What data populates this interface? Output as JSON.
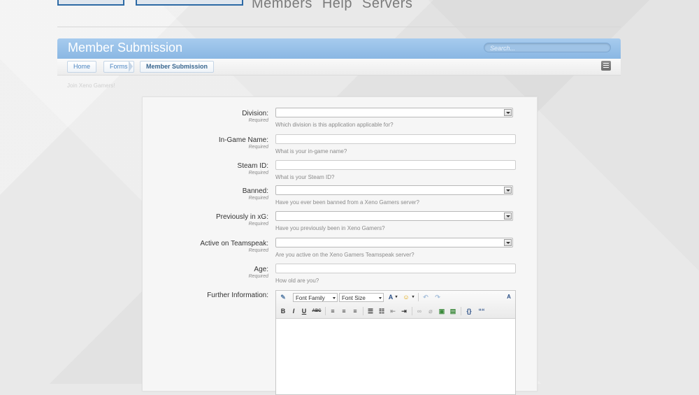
{
  "nav": {
    "items": [
      "Members",
      "Help",
      "Servers"
    ]
  },
  "header": {
    "title": "Member Submission",
    "search_placeholder": "Search..."
  },
  "breadcrumb": [
    "Home",
    "Forms",
    "Member Submission"
  ],
  "subtext": "Join Xeno Gamers!",
  "form": {
    "required_text": "Required",
    "fields": [
      {
        "label": "Division:",
        "type": "select",
        "hint": "Which division is this application applicable for?"
      },
      {
        "label": "In-Game Name:",
        "type": "text",
        "hint": "What is your in-game name?"
      },
      {
        "label": "Steam ID:",
        "type": "text",
        "hint": "What is your Steam ID?"
      },
      {
        "label": "Banned:",
        "type": "select",
        "hint": "Have you ever been banned from a Xeno Gamers server?"
      },
      {
        "label": "Previously in xG:",
        "type": "select",
        "hint": "Have you previously been in Xeno Gamers?"
      },
      {
        "label": "Active on Teamspeak:",
        "type": "select",
        "hint": "Are you active on the Xeno Gamers Teamspeak server?"
      },
      {
        "label": "Age:",
        "type": "text",
        "hint": "How old are you?"
      }
    ],
    "further_label": "Further Information:"
  },
  "editor": {
    "font_family": "Font Family",
    "font_size": "Font Size",
    "bold": "B",
    "italic": "I",
    "underline": "U",
    "strike": "ABC",
    "color_letter": "A",
    "quote": "““",
    "code": "{}",
    "sizer": "A"
  }
}
